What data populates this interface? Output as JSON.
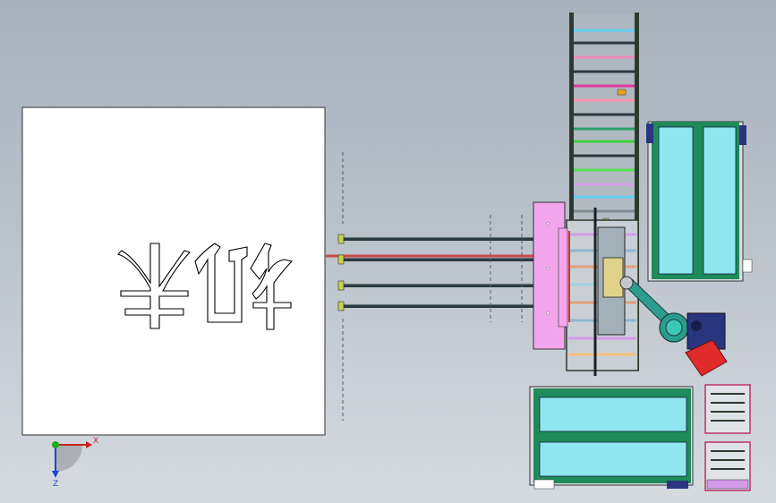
{
  "view": {
    "kind": "cad-top-view",
    "background_top": "#a7b1bc",
    "background_bottom": "#d6dbe0"
  },
  "triad": {
    "x_label": "X",
    "z_label": "Z",
    "x_color": "#cc2222",
    "y_color": "#22aa22",
    "z_color": "#2244cc"
  },
  "panel": {
    "name": "white-panel",
    "color": "#ffffff",
    "glyph_outline": "black"
  },
  "colors": {
    "frame": "#2d3a2f",
    "cyan_panel": "#8fe6ee",
    "green_frame": "#1f8a5a",
    "pink_plate": "#f4a6ec",
    "robot_teal": "#2a9d8f",
    "robot_motor": "#e02b2b",
    "navy_base": "#2a3580"
  }
}
